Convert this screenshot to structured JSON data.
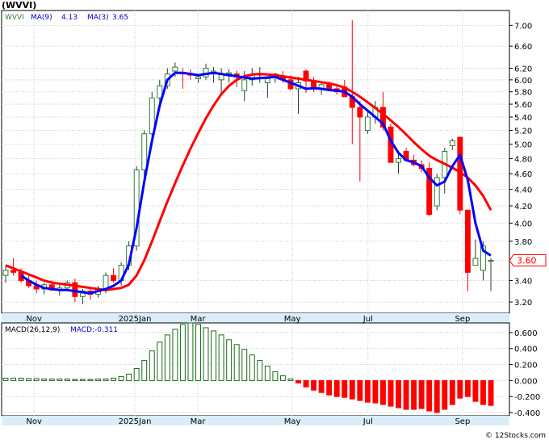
{
  "symbol_title": "(WVVI)",
  "price_legend": {
    "ticker": "WVVI",
    "ma9_label": "MA(9)",
    "ma9_value": "4.13",
    "ma3_label": "MA(3)",
    "ma3_value": "3.65"
  },
  "macd_legend": {
    "label": "MACD(26,12,9)",
    "value_label": "MACD:-0.311"
  },
  "last_price_label": "3.60",
  "watermark": "© 12Stocks.com",
  "colors": {
    "up_candle": "#2e7d32",
    "down_candle": "#ff0000",
    "ma_fast": "#0000ff",
    "ma_slow": "#ff0000",
    "macd_pos": "#1a6b1a",
    "macd_neg": "#ff0000",
    "axis_band": "#d9eef8",
    "grid": "#c8c8c8"
  },
  "chart_data": [
    {
      "type": "candlestick",
      "title": "(WVVI)",
      "x_tick_labels": [
        "Nov",
        "2025Jan",
        "Mar",
        "May",
        "Jul",
        "Sep"
      ],
      "y_tick_labels": [
        "7.00",
        "6.60",
        "6.20",
        "6.00",
        "5.80",
        "5.60",
        "5.40",
        "5.20",
        "5.00",
        "4.80",
        "4.60",
        "4.40",
        "4.20",
        "4.00",
        "3.80",
        "3.60",
        "3.40",
        "3.20"
      ],
      "ylim": [
        3.1,
        7.3
      ],
      "y_scale": "log",
      "grid": true,
      "candles": [
        [
          3.45,
          3.55,
          3.38,
          3.5
        ],
        [
          3.5,
          3.62,
          3.45,
          3.48
        ],
        [
          3.48,
          3.52,
          3.38,
          3.4
        ],
        [
          3.4,
          3.45,
          3.33,
          3.35
        ],
        [
          3.35,
          3.4,
          3.28,
          3.32
        ],
        [
          3.32,
          3.38,
          3.27,
          3.36
        ],
        [
          3.36,
          3.4,
          3.3,
          3.31
        ],
        [
          3.31,
          3.36,
          3.26,
          3.33
        ],
        [
          3.33,
          3.4,
          3.3,
          3.38
        ],
        [
          3.38,
          3.42,
          3.2,
          3.25
        ],
        [
          3.25,
          3.32,
          3.18,
          3.3
        ],
        [
          3.3,
          3.33,
          3.22,
          3.27
        ],
        [
          3.27,
          3.35,
          3.24,
          3.32
        ],
        [
          3.32,
          3.48,
          3.28,
          3.45
        ],
        [
          3.45,
          3.52,
          3.38,
          3.4
        ],
        [
          3.4,
          3.58,
          3.35,
          3.55
        ],
        [
          3.55,
          3.8,
          3.5,
          3.75
        ],
        [
          3.75,
          4.7,
          3.7,
          4.65
        ],
        [
          4.65,
          5.2,
          4.55,
          5.15
        ],
        [
          5.15,
          5.8,
          5.05,
          5.7
        ],
        [
          5.7,
          6.0,
          5.55,
          5.9
        ],
        [
          5.9,
          6.2,
          5.85,
          6.1
        ],
        [
          6.15,
          6.3,
          6.05,
          6.22
        ],
        [
          6.12,
          6.2,
          5.85,
          6.1
        ],
        [
          6.1,
          6.18,
          6.0,
          6.08
        ],
        [
          6.02,
          6.1,
          5.95,
          6.05
        ],
        [
          6.05,
          6.28,
          6.0,
          6.2
        ],
        [
          6.1,
          6.22,
          5.95,
          6.15
        ],
        [
          6.0,
          6.2,
          5.75,
          6.1
        ],
        [
          6.1,
          6.18,
          5.95,
          6.12
        ],
        [
          6.1,
          6.16,
          5.88,
          6.05
        ],
        [
          5.82,
          6.15,
          5.65,
          6.0
        ],
        [
          6.0,
          6.2,
          5.9,
          6.08
        ],
        [
          6.08,
          6.22,
          5.95,
          6.1
        ],
        [
          5.95,
          6.05,
          5.7,
          6.02
        ],
        [
          6.05,
          6.12,
          5.95,
          6.1
        ],
        [
          6.05,
          6.15,
          5.95,
          6.0
        ],
        [
          6.0,
          6.08,
          5.82,
          5.85
        ],
        [
          5.85,
          6.05,
          5.45,
          5.95
        ],
        [
          6.15,
          6.18,
          5.78,
          5.98
        ],
        [
          5.98,
          6.05,
          5.8,
          5.85
        ],
        [
          5.85,
          5.95,
          5.75,
          5.92
        ],
        [
          5.92,
          5.97,
          5.82,
          5.85
        ],
        [
          5.85,
          5.9,
          5.75,
          5.8
        ],
        [
          5.88,
          6.0,
          5.75,
          5.72
        ],
        [
          5.72,
          7.1,
          5.0,
          5.55
        ],
        [
          5.55,
          5.65,
          4.5,
          5.4
        ],
        [
          5.2,
          5.5,
          5.15,
          5.4
        ],
        [
          5.4,
          5.65,
          5.3,
          5.55
        ],
        [
          5.55,
          5.8,
          5.2,
          5.25
        ],
        [
          5.25,
          5.3,
          4.8,
          4.75
        ],
        [
          4.75,
          4.9,
          4.6,
          4.8
        ],
        [
          4.9,
          4.95,
          4.78,
          4.78
        ],
        [
          4.78,
          4.85,
          4.7,
          4.72
        ],
        [
          4.72,
          4.78,
          4.62,
          4.67
        ],
        [
          4.67,
          4.75,
          4.08,
          4.1
        ],
        [
          4.2,
          4.6,
          4.15,
          4.55
        ],
        [
          4.55,
          4.95,
          4.35,
          4.9
        ],
        [
          4.98,
          5.08,
          4.92,
          5.05
        ],
        [
          5.1,
          5.1,
          4.1,
          4.15
        ],
        [
          4.15,
          4.15,
          3.3,
          3.48
        ],
        [
          3.55,
          3.82,
          3.55,
          3.62
        ],
        [
          3.5,
          3.8,
          3.4,
          3.75
        ],
        [
          3.6,
          3.62,
          3.3,
          3.6
        ]
      ],
      "series": [
        {
          "name": "MA(9)",
          "values": [
            3.55,
            3.52,
            3.49,
            3.46,
            3.43,
            3.4,
            3.38,
            3.37,
            3.36,
            3.35,
            3.34,
            3.33,
            3.32,
            3.31,
            3.32,
            3.33,
            3.36,
            3.45,
            3.6,
            3.8,
            4.02,
            4.25,
            4.48,
            4.71,
            4.94,
            5.16,
            5.38,
            5.58,
            5.76,
            5.9,
            6.0,
            6.06,
            6.09,
            6.1,
            6.09,
            6.08,
            6.06,
            6.04,
            6.02,
            6.0,
            5.98,
            5.96,
            5.94,
            5.91,
            5.87,
            5.8,
            5.72,
            5.63,
            5.54,
            5.45,
            5.35,
            5.25,
            5.14,
            5.03,
            4.93,
            4.84,
            4.78,
            4.73,
            4.68,
            4.62,
            4.55,
            4.45,
            4.32,
            4.15
          ]
        },
        {
          "name": "MA(3)",
          "values": [
            null,
            null,
            3.45,
            3.4,
            3.36,
            3.33,
            3.32,
            3.31,
            3.31,
            3.3,
            3.29,
            3.28,
            3.3,
            3.32,
            3.35,
            3.4,
            3.56,
            3.95,
            4.5,
            5.05,
            5.58,
            6.0,
            6.12,
            6.12,
            6.1,
            6.08,
            6.1,
            6.12,
            6.1,
            6.08,
            6.06,
            6.04,
            6.02,
            6.03,
            6.04,
            6.05,
            6.0,
            5.95,
            5.9,
            5.85,
            5.86,
            5.85,
            5.83,
            5.82,
            5.8,
            5.72,
            5.6,
            5.5,
            5.4,
            5.3,
            5.05,
            4.88,
            4.78,
            4.75,
            4.7,
            4.55,
            4.45,
            4.5,
            4.7,
            4.85,
            4.52,
            4.0,
            3.7,
            3.65
          ]
        }
      ]
    },
    {
      "type": "bar",
      "title": "MACD(26,12,9)",
      "x_tick_labels": [
        "Nov",
        "2025Jan",
        "Mar",
        "May",
        "Jul",
        "Sep"
      ],
      "y_tick_labels": [
        "0.600",
        "0.400",
        "0.200",
        "0.000",
        "-0.200",
        "-0.400"
      ],
      "ylim": [
        -0.44,
        0.72
      ],
      "grid": true,
      "values": [
        0.03,
        0.03,
        0.03,
        0.025,
        0.025,
        0.02,
        0.02,
        0.02,
        0.02,
        0.015,
        0.015,
        0.015,
        0.02,
        0.02,
        0.03,
        0.05,
        0.08,
        0.15,
        0.25,
        0.37,
        0.48,
        0.57,
        0.64,
        0.7,
        0.72,
        0.7,
        0.66,
        0.62,
        0.57,
        0.51,
        0.45,
        0.39,
        0.32,
        0.25,
        0.18,
        0.11,
        0.06,
        0.02,
        -0.03,
        -0.08,
        -0.12,
        -0.15,
        -0.18,
        -0.2,
        -0.21,
        -0.23,
        -0.25,
        -0.27,
        -0.28,
        -0.3,
        -0.32,
        -0.34,
        -0.36,
        -0.36,
        -0.35,
        -0.38,
        -0.4,
        -0.36,
        -0.3,
        -0.22,
        -0.2,
        -0.26,
        -0.3,
        -0.311
      ]
    }
  ]
}
